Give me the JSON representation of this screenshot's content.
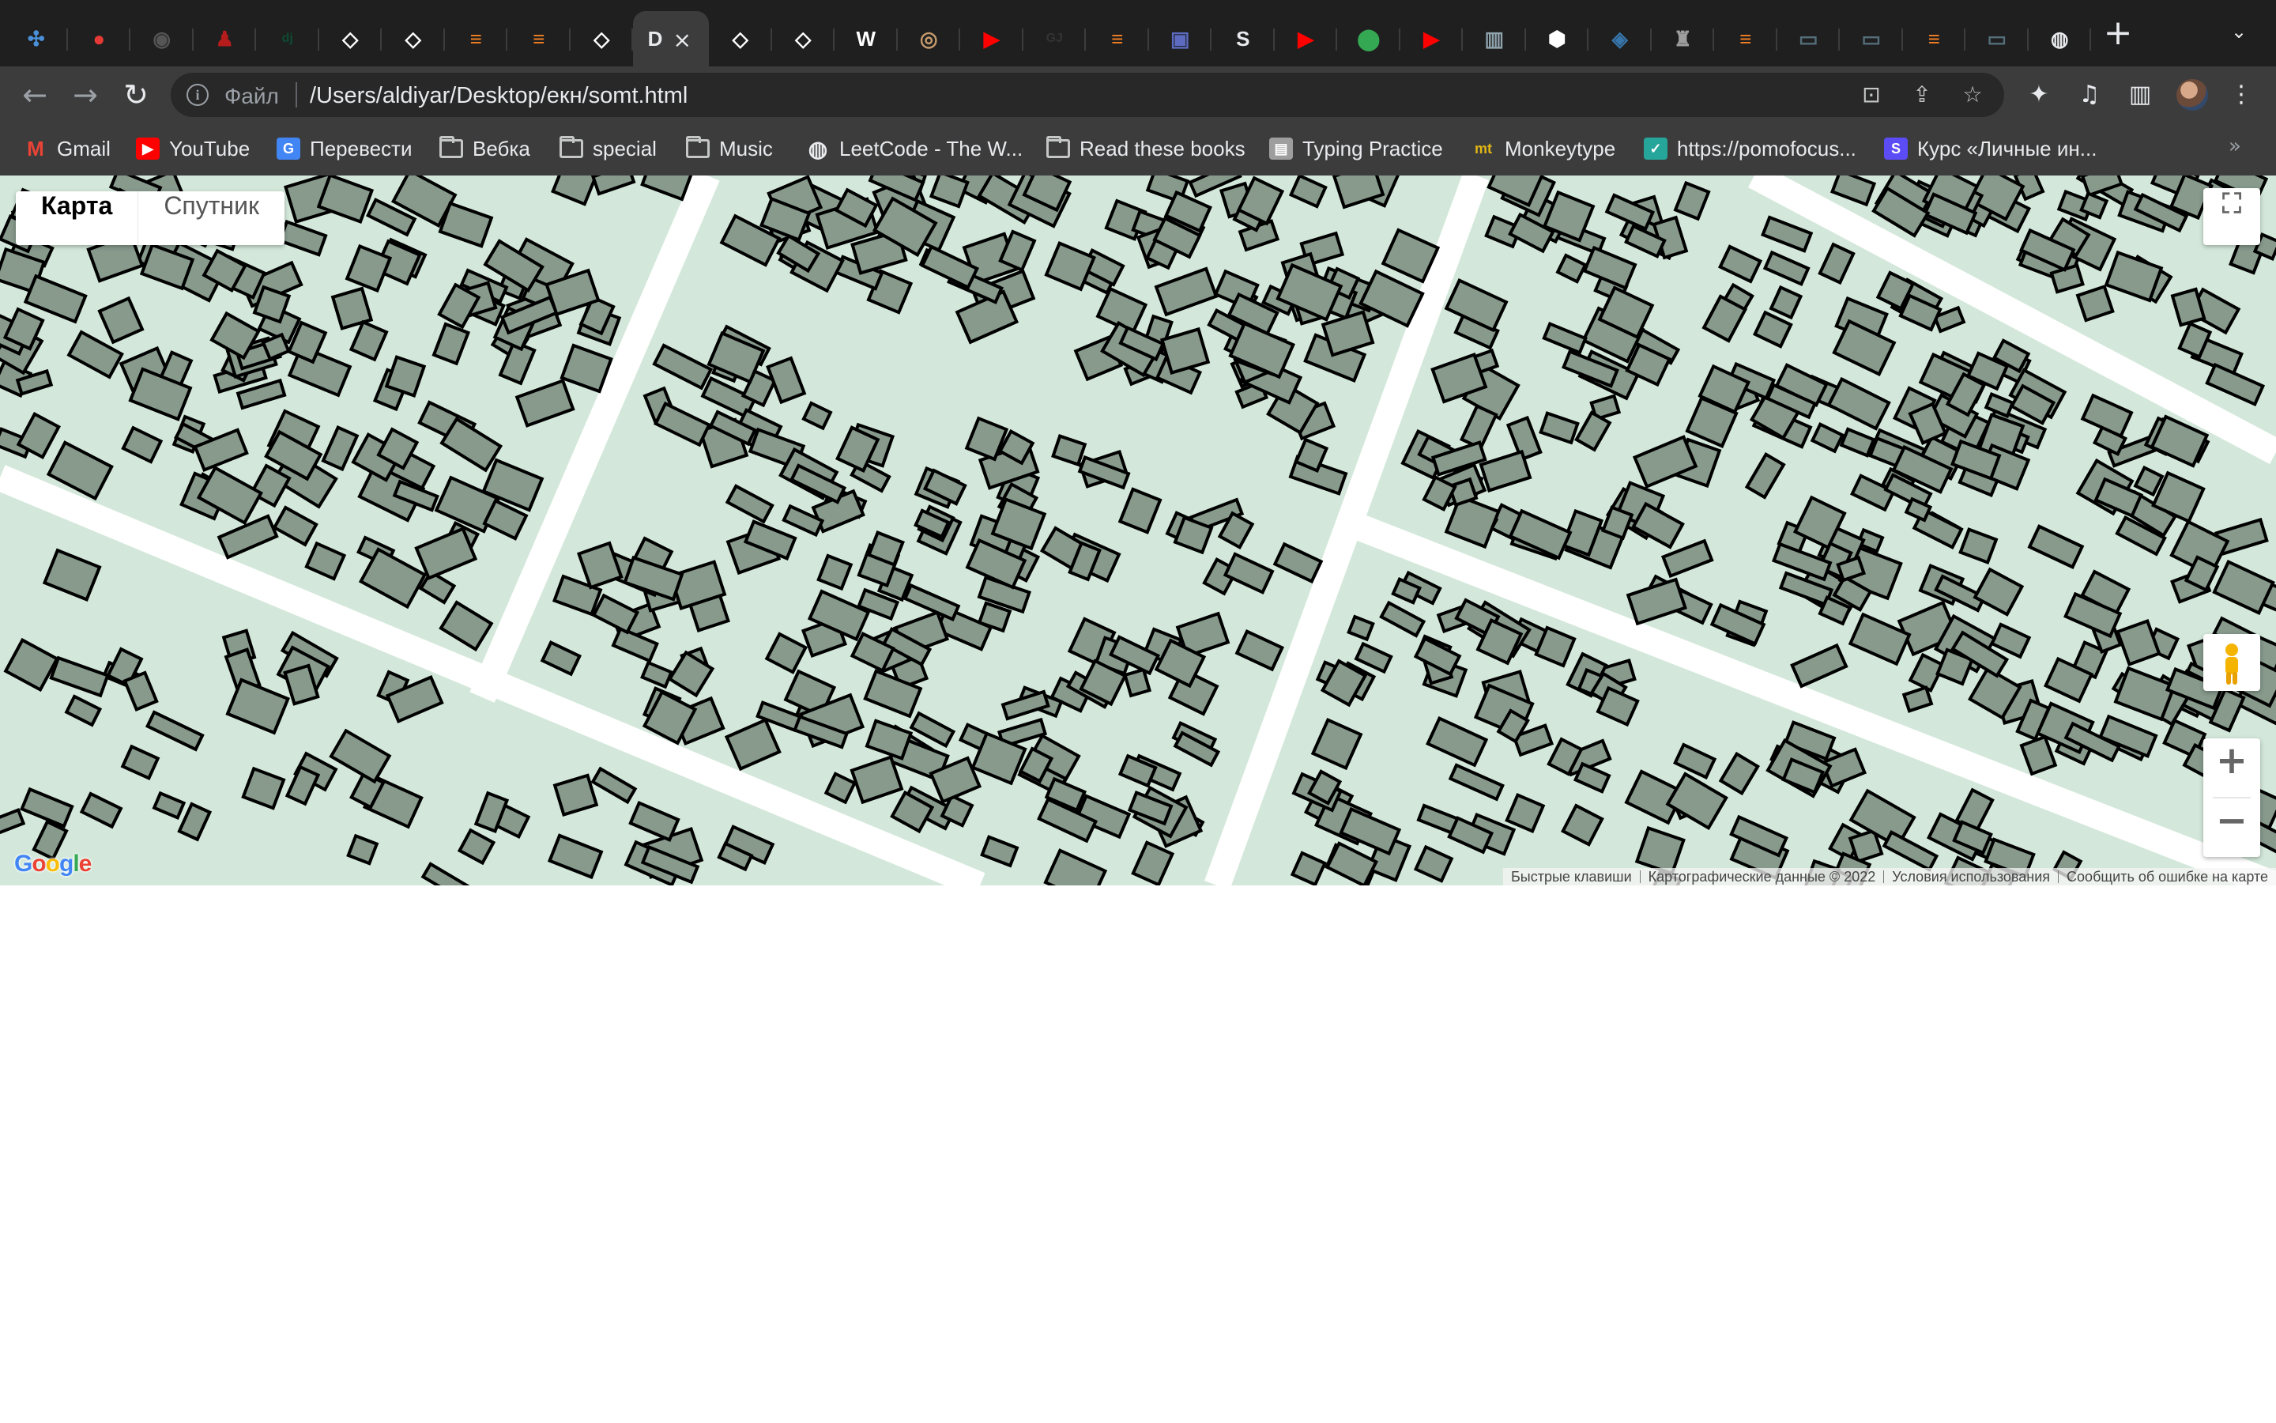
{
  "tabs": [
    {
      "icon": "apps-icon",
      "color": "#4a90d9",
      "glyph": "✣"
    },
    {
      "icon": "red-circle-icon",
      "color": "#e53935",
      "glyph": "●"
    },
    {
      "icon": "github-icon",
      "color": "#555555",
      "glyph": "◉"
    },
    {
      "icon": "figure-icon",
      "color": "#b71c1c",
      "glyph": "♟"
    },
    {
      "icon": "django-icon",
      "color": "#0c4b33",
      "glyph": "dj"
    },
    {
      "icon": "code-icon",
      "color": "#ffffff",
      "glyph": "◇"
    },
    {
      "icon": "code-icon",
      "color": "#ffffff",
      "glyph": "◇"
    },
    {
      "icon": "stackoverflow-icon",
      "color": "#f48024",
      "glyph": "≡"
    },
    {
      "icon": "stackoverflow-icon",
      "color": "#f48024",
      "glyph": "≡"
    },
    {
      "icon": "code-icon",
      "color": "#ffffff",
      "glyph": "◇"
    },
    {
      "icon": "document-icon",
      "color": "#9aa0a6",
      "glyph": "D",
      "active": true
    },
    {
      "icon": "code-icon",
      "color": "#ffffff",
      "glyph": "◇"
    },
    {
      "icon": "code-icon",
      "color": "#ffffff",
      "glyph": "◇"
    },
    {
      "icon": "wikipedia-icon",
      "color": "#ffffff",
      "glyph": "W"
    },
    {
      "icon": "round-logo-icon",
      "color": "#c49a6c",
      "glyph": "◎"
    },
    {
      "icon": "youtube-icon",
      "color": "#ff0000",
      "glyph": "▶"
    },
    {
      "icon": "gj-icon",
      "color": "#333333",
      "glyph": "GJ"
    },
    {
      "icon": "stackoverflow-icon",
      "color": "#f48024",
      "glyph": "≡"
    },
    {
      "icon": "image-icon",
      "color": "#5c6bc0",
      "glyph": "▣"
    },
    {
      "icon": "audio-icon",
      "color": "#e8eaed",
      "glyph": "S"
    },
    {
      "icon": "youtube-icon",
      "color": "#ff0000",
      "glyph": "▶"
    },
    {
      "icon": "maps-pin-icon",
      "color": "#34a853",
      "glyph": "⬤"
    },
    {
      "icon": "youtube-icon",
      "color": "#ff0000",
      "glyph": "▶"
    },
    {
      "icon": "book-icon",
      "color": "#90a4ae",
      "glyph": "▥"
    },
    {
      "icon": "cube-icon",
      "color": "#ffffff",
      "glyph": "⬢"
    },
    {
      "icon": "python-icon",
      "color": "#3776ab",
      "glyph": "◈"
    },
    {
      "icon": "figure-icon",
      "color": "#9e9e9e",
      "glyph": "♜"
    },
    {
      "icon": "stackoverflow-icon",
      "color": "#f48024",
      "glyph": "≡"
    },
    {
      "icon": "terminal-icon",
      "color": "#546e7a",
      "glyph": "▭"
    },
    {
      "icon": "terminal-icon",
      "color": "#546e7a",
      "glyph": "▭"
    },
    {
      "icon": "stackoverflow-icon",
      "color": "#f48024",
      "glyph": "≡"
    },
    {
      "icon": "terminal-icon",
      "color": "#546e7a",
      "glyph": "▭"
    },
    {
      "icon": "globe-icon",
      "color": "#e8eaed",
      "glyph": "◍"
    }
  ],
  "toolbar": {
    "scheme": "Файл",
    "url": "/Users/aldiyar/Desktop/екн/somt.html"
  },
  "bookmarks": [
    {
      "label": "Gmail",
      "icon": "gmail-icon",
      "glyph": "M",
      "color": "#ea4335"
    },
    {
      "label": "YouTube",
      "icon": "youtube-icon",
      "glyph": "▶",
      "color": "#ff0000"
    },
    {
      "label": "Перевести",
      "icon": "translate-icon",
      "glyph": "G",
      "color": "#4285f4"
    },
    {
      "label": "Вебка",
      "icon": "folder-icon",
      "folder": true
    },
    {
      "label": "special",
      "icon": "folder-icon",
      "folder": true
    },
    {
      "label": "Music",
      "icon": "folder-icon",
      "folder": true
    },
    {
      "label": "LeetCode - The W...",
      "icon": "globe-icon",
      "glyph": "◍",
      "color": "#3c3c3c"
    },
    {
      "label": "Read these books",
      "icon": "folder-icon",
      "folder": true
    },
    {
      "label": "Typing Practice",
      "icon": "typing-icon",
      "glyph": "▤",
      "color": "#9e9e9e"
    },
    {
      "label": "Monkeytype",
      "icon": "monkeytype-icon",
      "glyph": "mt",
      "color": "#3c3c3c"
    },
    {
      "label": "https://pomofocus...",
      "icon": "check-icon",
      "glyph": "✓",
      "color": "#26a69a"
    },
    {
      "label": "Курс «Личные ин...",
      "icon": "s-icon",
      "glyph": "S",
      "color": "#5b4cf5"
    }
  ],
  "map": {
    "type_buttons": [
      "Карта",
      "Спутник"
    ],
    "attribution": [
      "Быстрые клавиши",
      "Картографические данные © 2022",
      "Условия использования",
      "Сообщить об ошибке на карте"
    ],
    "logo": "Google",
    "colors": {
      "land": "#d3e8da",
      "road": "#ffffff",
      "building": "#879a8c",
      "outline": "#000000"
    }
  }
}
